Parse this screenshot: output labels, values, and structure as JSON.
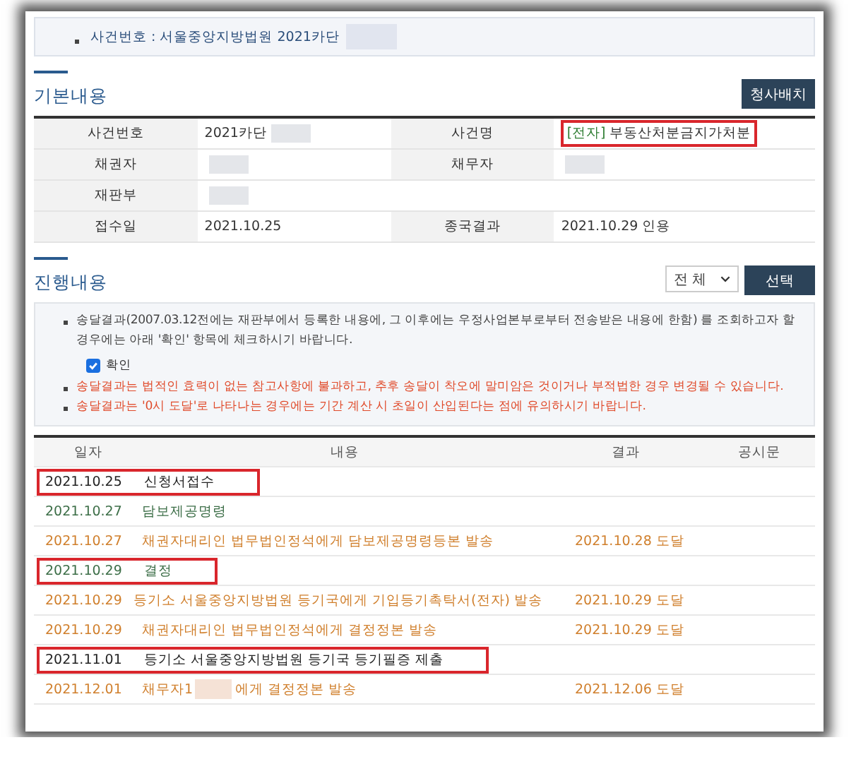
{
  "case_header": {
    "label": "사건번호 : 서울중앙지방법원 2021카단",
    "redacted": true
  },
  "basic_info": {
    "title": "기본내용",
    "button": "청사배치",
    "rows": [
      {
        "cells": [
          {
            "label": "사건번호",
            "value": "2021카단",
            "redacted": true
          },
          {
            "label": "사건명",
            "prefix": "[전자]",
            "value": "부동산처분금지가처분",
            "highlighted": true
          }
        ]
      },
      {
        "cells": [
          {
            "label": "채권자",
            "redacted": true
          },
          {
            "label": "채무자",
            "redacted": true
          }
        ]
      },
      {
        "cells": [
          {
            "label": "재판부",
            "redacted": true
          }
        ]
      },
      {
        "cells": [
          {
            "label": "접수일",
            "value": "2021.10.25"
          },
          {
            "label": "종국결과",
            "value": "2021.10.29 인용"
          }
        ]
      }
    ]
  },
  "progress": {
    "title": "진행내용",
    "filter": "전 체",
    "button": "선택",
    "notices": [
      {
        "text": "송달결과(2007.03.12전에는 재판부에서 등록한 내용에, 그 이후에는 우정사업본부로부터 전송받은 내용에 한함) 를 조회하고자 할 경우에는 아래 '확인' 항목에 체크하시기 바랍니다.",
        "kind": "info"
      },
      {
        "text": "확인",
        "kind": "checkbox",
        "checked": true
      },
      {
        "text": "송달결과는 법적인 효력이 없는 참고사항에 불과하고, 추후 송달이 착오에 말미암은 것이거나 부적법한 경우 변경될 수 있습니다.",
        "kind": "warning"
      },
      {
        "text": "송달결과는 '0시 도달'로 나타나는 경우에는 기간 계산 시 초일이 산입된다는 점에 유의하시기 바랍니다.",
        "kind": "warning"
      }
    ],
    "table": {
      "columns": [
        "일자",
        "내용",
        "결과",
        "공시문"
      ],
      "rows": [
        {
          "date": "2021.10.25",
          "content": "신청서접수",
          "kind": "filing",
          "highlighted": true
        },
        {
          "date": "2021.10.27",
          "content": "담보제공명령",
          "kind": "order",
          "highlighted": false
        },
        {
          "date": "2021.10.27",
          "content": "채권자대리인 법무법인정석에게 담보제공명령등본 발송",
          "result": "2021.10.28 도달",
          "kind": "delivery",
          "highlighted": false
        },
        {
          "date": "2021.10.29",
          "content": "결정",
          "kind": "order",
          "highlighted": true
        },
        {
          "date": "2021.10.29",
          "content": "등기소 서울중앙지방법원 등기국에게 기입등기촉탁서(전자) 발송",
          "result": "2021.10.29 도달",
          "kind": "delivery",
          "highlighted": false
        },
        {
          "date": "2021.10.29",
          "content": "채권자대리인 법무법인정석에게 결정정본 발송",
          "result": "2021.10.29 도달",
          "kind": "delivery",
          "highlighted": false
        },
        {
          "date": "2021.11.01",
          "content": "등기소 서울중앙지방법원 등기국 등기필증 제출",
          "kind": "filing",
          "highlighted": true
        },
        {
          "date": "2021.12.01",
          "content": "채무자1",
          "content_after": "에게 결정정본 발송",
          "redacted": true,
          "result": "2021.12.06 도달",
          "kind": "delivery",
          "highlighted": false
        }
      ]
    }
  }
}
